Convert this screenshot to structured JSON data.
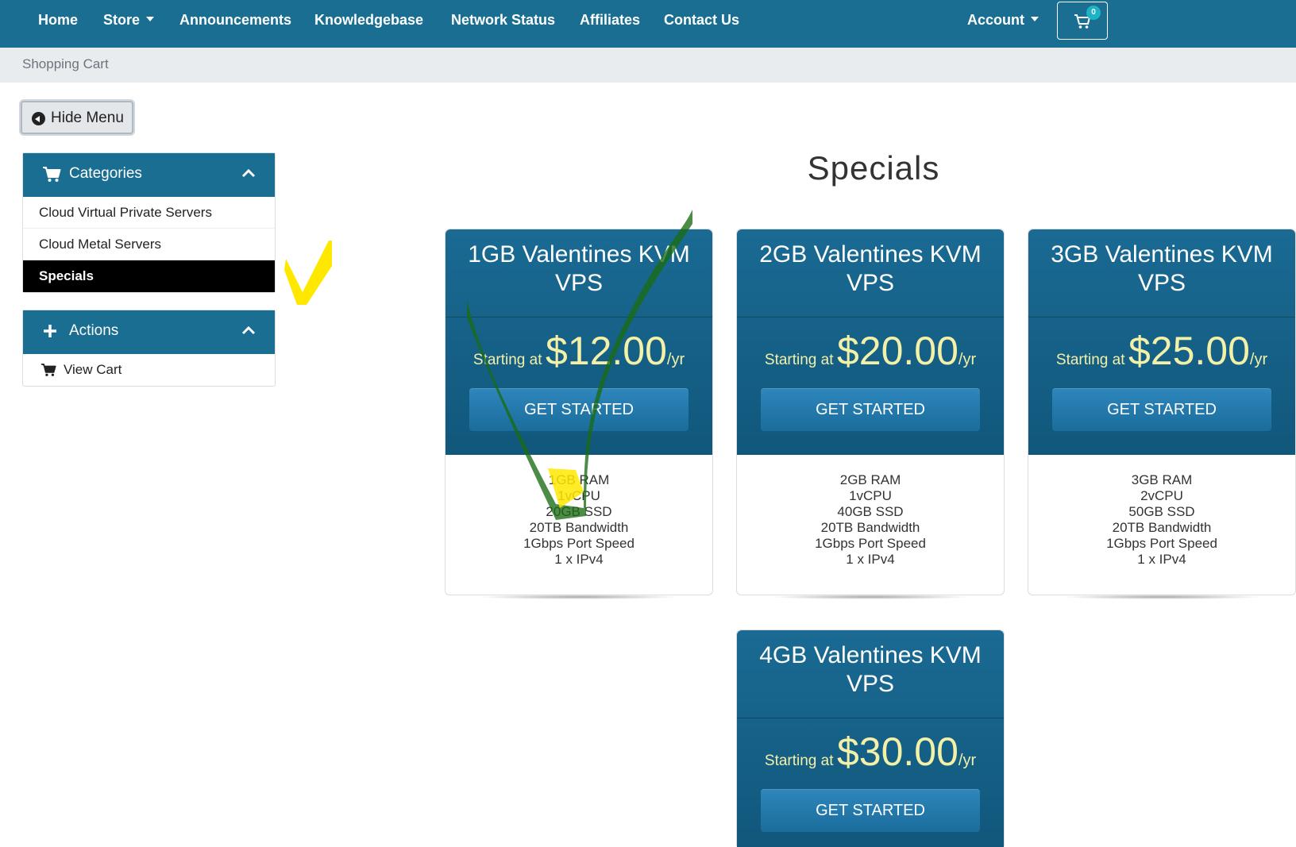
{
  "nav": {
    "items": [
      {
        "label": "Home",
        "dropdown": false
      },
      {
        "label": "Store",
        "dropdown": true
      },
      {
        "label": "Announcements",
        "dropdown": false
      },
      {
        "label": "Knowledgebase",
        "dropdown": false
      },
      {
        "label": "Network Status",
        "dropdown": false
      },
      {
        "label": "Affiliates",
        "dropdown": false
      },
      {
        "label": "Contact Us",
        "dropdown": false
      }
    ],
    "account_label": "Account",
    "cart_count": "0"
  },
  "breadcrumb": {
    "current": "Shopping Cart"
  },
  "hide_menu_label": "Hide Menu",
  "sidebar": {
    "categories": {
      "title": "Categories",
      "items": [
        {
          "label": "Cloud Virtual Private Servers",
          "active": false
        },
        {
          "label": "Cloud Metal Servers",
          "active": false
        },
        {
          "label": "Specials",
          "active": true
        }
      ]
    },
    "actions": {
      "title": "Actions",
      "items": [
        {
          "label": "View Cart"
        }
      ]
    }
  },
  "main": {
    "title": "Specials",
    "products": [
      {
        "name_line1": "1GB Valentines KVM",
        "name_line2": "VPS",
        "price_prefix": "Starting at",
        "price": "$12.00",
        "price_period": "/yr",
        "button_label": "GET STARTED",
        "features": [
          "1GB RAM",
          "1vCPU",
          "20GB SSD",
          "20TB Bandwidth",
          "1Gbps Port Speed",
          "1 x IPv4"
        ]
      },
      {
        "name_line1": "2GB Valentines KVM",
        "name_line2": "VPS",
        "price_prefix": "Starting at",
        "price": "$20.00",
        "price_period": "/yr",
        "button_label": "GET STARTED",
        "features": [
          "2GB RAM",
          "1vCPU",
          "40GB SSD",
          "20TB Bandwidth",
          "1Gbps Port Speed",
          "1 x IPv4"
        ]
      },
      {
        "name_line1": "3GB Valentines KVM",
        "name_line2": "VPS",
        "price_prefix": "Starting at",
        "price": "$25.00",
        "price_period": "/yr",
        "button_label": "GET STARTED",
        "features": [
          "3GB RAM",
          "2vCPU",
          "50GB SSD",
          "20TB Bandwidth",
          "1Gbps Port Speed",
          "1 x IPv4"
        ]
      },
      {
        "name_line1": "4GB Valentines KVM",
        "name_line2": "VPS",
        "price_prefix": "Starting at",
        "price": "$30.00",
        "price_period": "/yr",
        "button_label": "GET STARTED",
        "features": []
      }
    ]
  },
  "colors": {
    "navbar": "#1a6e91",
    "card_header": "#11577c",
    "price_text": "#f3f0a7",
    "active_item": "#000000",
    "annotation_yellow": "#ffe800",
    "annotation_green": "#1a6b12"
  }
}
